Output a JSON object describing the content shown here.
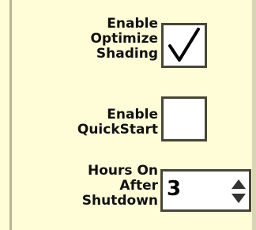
{
  "settings": {
    "optimize_shading": {
      "label_lines": [
        "Enable",
        "Optimize",
        "Shading"
      ],
      "checked": true
    },
    "quickstart": {
      "label_lines": [
        "Enable",
        "QuickStart"
      ],
      "checked": false
    },
    "hours_on_after_shutdown": {
      "label_lines": [
        "Hours On",
        "After",
        "Shutdown"
      ],
      "value": "3"
    }
  },
  "icons": {
    "checkmark": "check-icon",
    "spinner": "up-down-arrows-icon"
  },
  "colors": {
    "panel_background": "#fffcd8",
    "control_border": "#4a4636"
  }
}
